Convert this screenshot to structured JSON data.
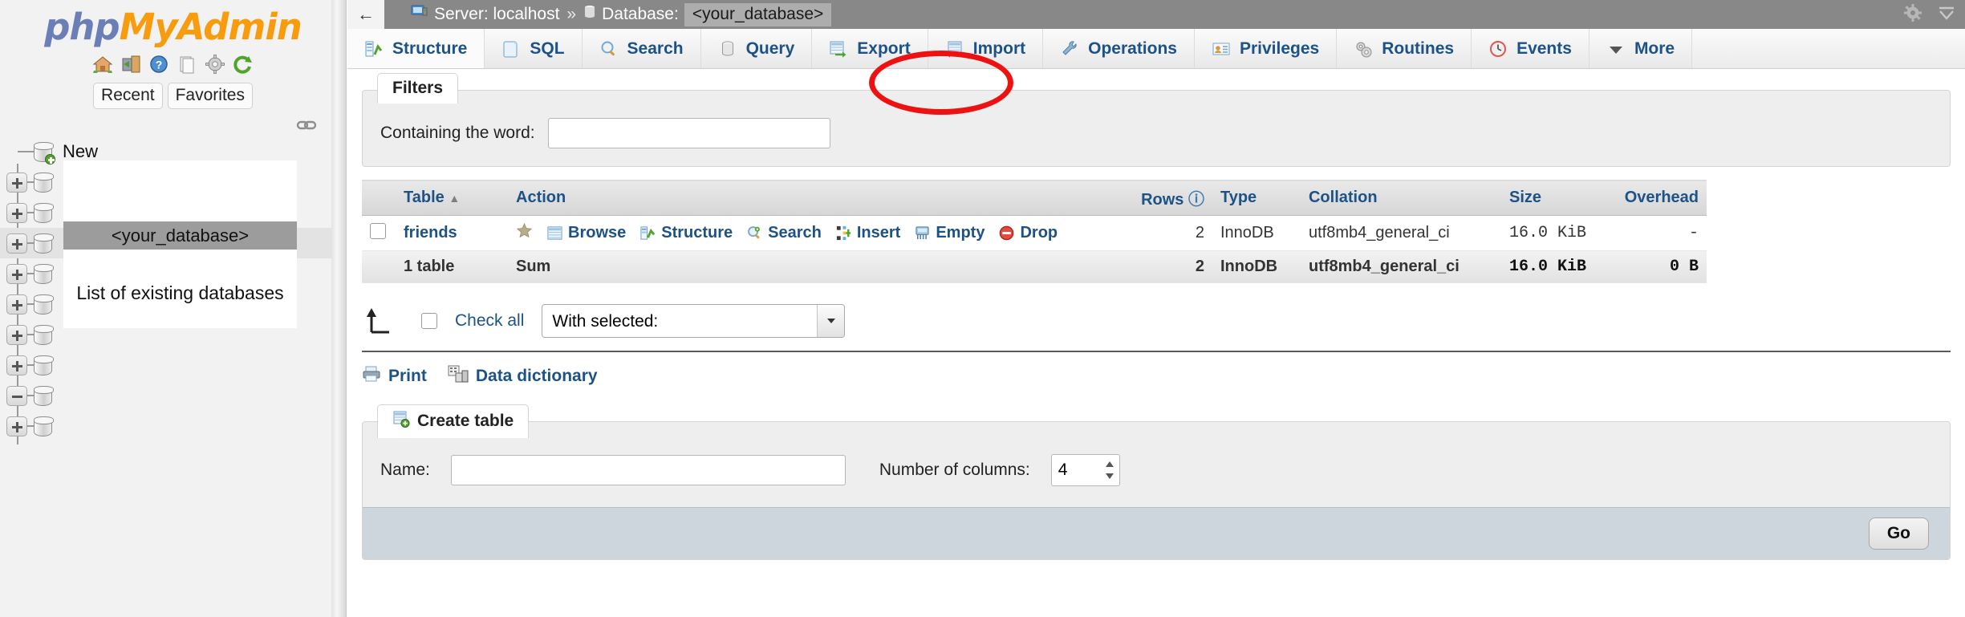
{
  "app": {
    "logo_php": "php",
    "logo_my": "My",
    "logo_admin": "Admin"
  },
  "sidebar": {
    "nav_icons": [
      "home-icon",
      "logout-icon",
      "help-icon",
      "docs-icon",
      "settings-icon",
      "reload-icon"
    ],
    "pills": [
      {
        "label": "Recent"
      },
      {
        "label": "Favorites"
      }
    ],
    "tree": {
      "new_label": "New",
      "selected_db": "<your_database>",
      "annotation": "List of existing databases",
      "nodes": [
        {
          "toggle": "plus"
        },
        {
          "toggle": "plus"
        },
        {
          "toggle": "plus"
        },
        {
          "toggle": "plus"
        },
        {
          "toggle": "plus"
        },
        {
          "toggle": "plus"
        },
        {
          "toggle": "plus"
        },
        {
          "toggle": "minus"
        },
        {
          "toggle": "plus"
        }
      ]
    }
  },
  "topbar": {
    "back_label": "←",
    "server_label": "Server: localhost",
    "separator": "»",
    "database_label": "Database:",
    "database_name": "<your_database>",
    "gear_icon": "gear-icon",
    "collapse_icon": "collapse-icon"
  },
  "tabs": [
    {
      "label": "Structure",
      "icon": "structure-icon",
      "active": true
    },
    {
      "label": "SQL",
      "icon": "sql-icon",
      "active": false
    },
    {
      "label": "Search",
      "icon": "search-icon",
      "active": false
    },
    {
      "label": "Query",
      "icon": "query-icon",
      "active": false
    },
    {
      "label": "Export",
      "icon": "export-icon",
      "active": false,
      "highlighted": true
    },
    {
      "label": "Import",
      "icon": "import-icon",
      "active": false
    },
    {
      "label": "Operations",
      "icon": "operations-icon",
      "active": false
    },
    {
      "label": "Privileges",
      "icon": "privileges-icon",
      "active": false
    },
    {
      "label": "Routines",
      "icon": "routines-icon",
      "active": false
    },
    {
      "label": "Events",
      "icon": "events-icon",
      "active": false
    },
    {
      "label": "More",
      "icon": "chevron-down-icon",
      "active": false
    }
  ],
  "filters": {
    "legend": "Filters",
    "containing_label": "Containing the word:",
    "containing_value": "",
    "containing_placeholder": ""
  },
  "table_list": {
    "headers": [
      "Table",
      "Action",
      "Rows",
      "Type",
      "Collation",
      "Size",
      "Overhead"
    ],
    "sort_indicator": "▲",
    "rows_help_icon": "help-icon",
    "rows": [
      {
        "name": "friends",
        "favorite_icon": "star-icon",
        "actions": [
          {
            "label": "Browse",
            "icon": "browse-icon"
          },
          {
            "label": "Structure",
            "icon": "structure-icon"
          },
          {
            "label": "Search",
            "icon": "search-icon"
          },
          {
            "label": "Insert",
            "icon": "insert-icon"
          },
          {
            "label": "Empty",
            "icon": "empty-icon"
          },
          {
            "label": "Drop",
            "icon": "drop-icon"
          }
        ],
        "rows_count": "2",
        "type": "InnoDB",
        "collation": "utf8mb4_general_ci",
        "size": "16.0 KiB",
        "overhead": "-"
      }
    ],
    "summary": {
      "table_count": "1 table",
      "sum_label": "Sum",
      "rows_count": "2",
      "type": "InnoDB",
      "collation": "utf8mb4_general_ci",
      "size": "16.0 KiB",
      "overhead": "0 B"
    }
  },
  "selection": {
    "check_all_label": "Check all",
    "with_selected_value": "With selected:",
    "with_selected_options": [
      "With selected:"
    ]
  },
  "footer_links": [
    {
      "label": "Print",
      "icon": "print-icon"
    },
    {
      "label": "Data dictionary",
      "icon": "data-dictionary-icon"
    }
  ],
  "create_table": {
    "legend": "Create table",
    "legend_icon": "create-table-icon",
    "name_label": "Name:",
    "name_value": "",
    "columns_label": "Number of columns:",
    "columns_value": "4",
    "go_label": "Go"
  },
  "colors": {
    "accent_link": "#1d5287",
    "highlight_red": "#ee1111",
    "topbar_gray": "#888888",
    "logo_blue": "#6c7eb7",
    "logo_orange": "#f89c0e"
  }
}
